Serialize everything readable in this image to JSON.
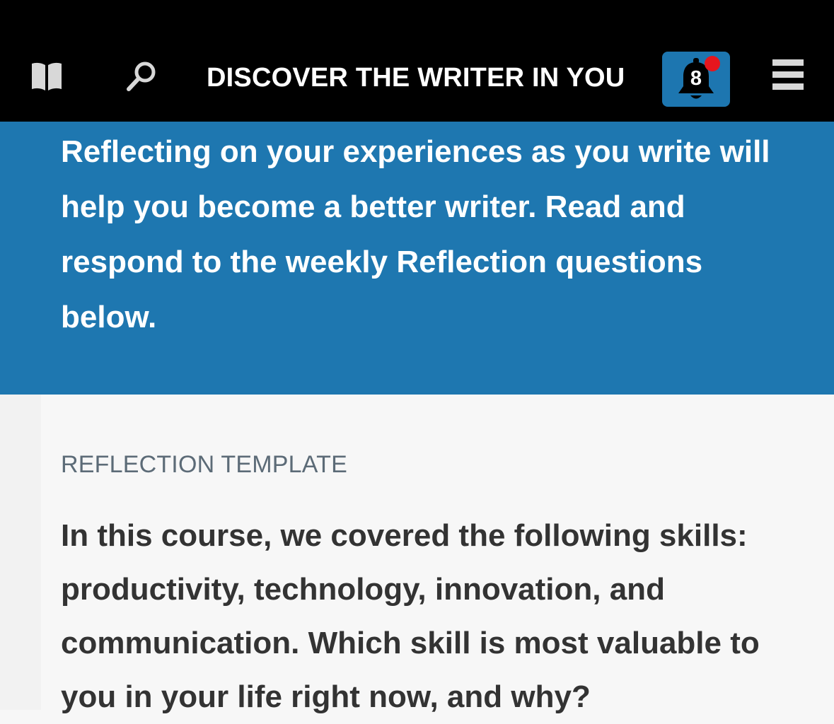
{
  "header": {
    "title": "DISCOVER THE WRITER IN YOU",
    "icons": {
      "book": "book-icon",
      "search": "search-icon",
      "bell": "bell-icon",
      "menu": "hamburger-menu-icon"
    },
    "notifications": {
      "count": "8"
    }
  },
  "banner": {
    "text": "Reflecting on your experiences as you write will help you become a better writer. Read and respond to the weekly Reflection questions below."
  },
  "content": {
    "section_label": "REFLECTION TEMPLATE",
    "question": "In this course, we covered the following skills: productivity, technology, innovation, and communication. Which skill is most valuable to you in your life right now, and why?"
  },
  "colors": {
    "header_bg": "#000000",
    "accent": "#1e77b0",
    "badge_dot": "#e6161d",
    "label_text": "#5c6b77",
    "body_text": "#333333",
    "page_bg": "#f7f7f7"
  }
}
